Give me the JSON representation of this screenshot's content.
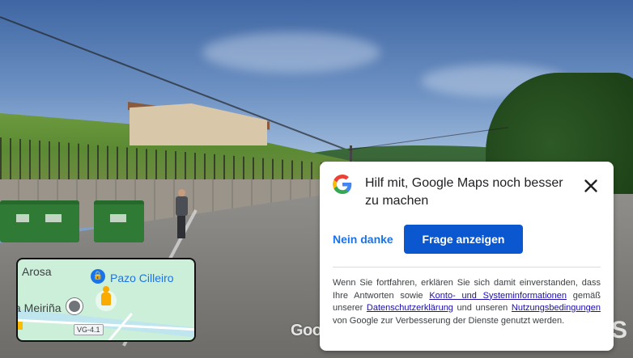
{
  "survey": {
    "title": "Hilf mit, Google Maps noch besser zu machen",
    "decline_label": "Nein danke",
    "accept_label": "Frage anzeigen",
    "legal": {
      "part1": "Wenn Sie fortfahren, erklären Sie sich damit einverstanden, dass Ihre Antworten sowie ",
      "link1": "Konto- und Systeminformationen",
      "part2": " gemäß unserer ",
      "link2": "Datenschutzerklärung",
      "part3": " und unseren ",
      "link3": "Nutzungsbedingungen",
      "part4": " von Google zur Verbesserung der Dienste genutzt werden."
    },
    "icons": {
      "logo": "google-g-logo",
      "close": "close-icon"
    },
    "colors": {
      "primary_button": "#0b57d0",
      "link": "#1a73e8"
    }
  },
  "minimap": {
    "town_label": "Arosa",
    "place_label": "Pazo Cilleiro",
    "area_label": "a Meiriña",
    "road_shield": "VG-4.1",
    "icons": {
      "place_pin": "place-pin-icon",
      "poi": "poi-icon",
      "pegman": "pegman-icon"
    }
  },
  "street_view": {
    "watermark": "Google",
    "watermark_right": "S"
  }
}
